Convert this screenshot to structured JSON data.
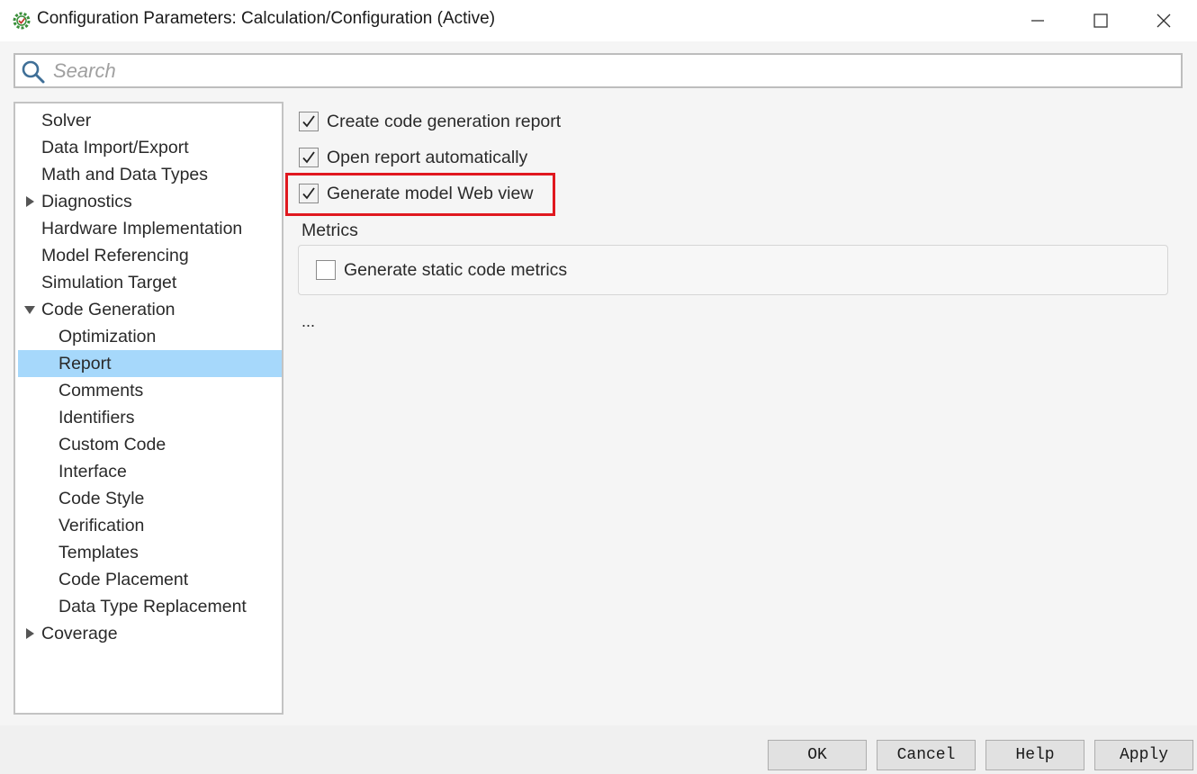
{
  "window": {
    "title": "Configuration Parameters: Calculation/Configuration (Active)",
    "icon": "simulink-gear-icon",
    "controls": [
      "minimize-icon",
      "maximize-icon",
      "close-icon"
    ]
  },
  "search": {
    "placeholder": "Search",
    "value": ""
  },
  "tree": {
    "items": [
      {
        "label": "Solver",
        "level": 0,
        "expandable": false
      },
      {
        "label": "Data Import/Export",
        "level": 0,
        "expandable": false
      },
      {
        "label": "Math and Data Types",
        "level": 0,
        "expandable": false
      },
      {
        "label": "Diagnostics",
        "level": 0,
        "expandable": true,
        "expanded": false
      },
      {
        "label": "Hardware Implementation",
        "level": 0,
        "expandable": false
      },
      {
        "label": "Model Referencing",
        "level": 0,
        "expandable": false
      },
      {
        "label": "Simulation Target",
        "level": 0,
        "expandable": false
      },
      {
        "label": "Code Generation",
        "level": 0,
        "expandable": true,
        "expanded": true
      },
      {
        "label": "Optimization",
        "level": 1
      },
      {
        "label": "Report",
        "level": 1,
        "selected": true
      },
      {
        "label": "Comments",
        "level": 1
      },
      {
        "label": "Identifiers",
        "level": 1
      },
      {
        "label": "Custom Code",
        "level": 1
      },
      {
        "label": "Interface",
        "level": 1
      },
      {
        "label": "Code Style",
        "level": 1
      },
      {
        "label": "Verification",
        "level": 1
      },
      {
        "label": "Templates",
        "level": 1
      },
      {
        "label": "Code Placement",
        "level": 1
      },
      {
        "label": "Data Type Replacement",
        "level": 1
      },
      {
        "label": "Coverage",
        "level": 0,
        "expandable": true,
        "expanded": false
      }
    ]
  },
  "report": {
    "create_report": {
      "label": "Create code generation report",
      "checked": true
    },
    "open_report": {
      "label": "Open report automatically",
      "checked": true
    },
    "web_view": {
      "label": "Generate model Web view",
      "checked": true
    },
    "metrics_title": "Metrics",
    "static_metrics": {
      "label": "Generate static code metrics",
      "checked": false
    },
    "ellipsis": "..."
  },
  "buttons": {
    "ok": "OK",
    "cancel": "Cancel",
    "help": "Help",
    "apply": "Apply"
  },
  "colors": {
    "selection": "#a6d8fb",
    "highlight": "#e0181f"
  }
}
